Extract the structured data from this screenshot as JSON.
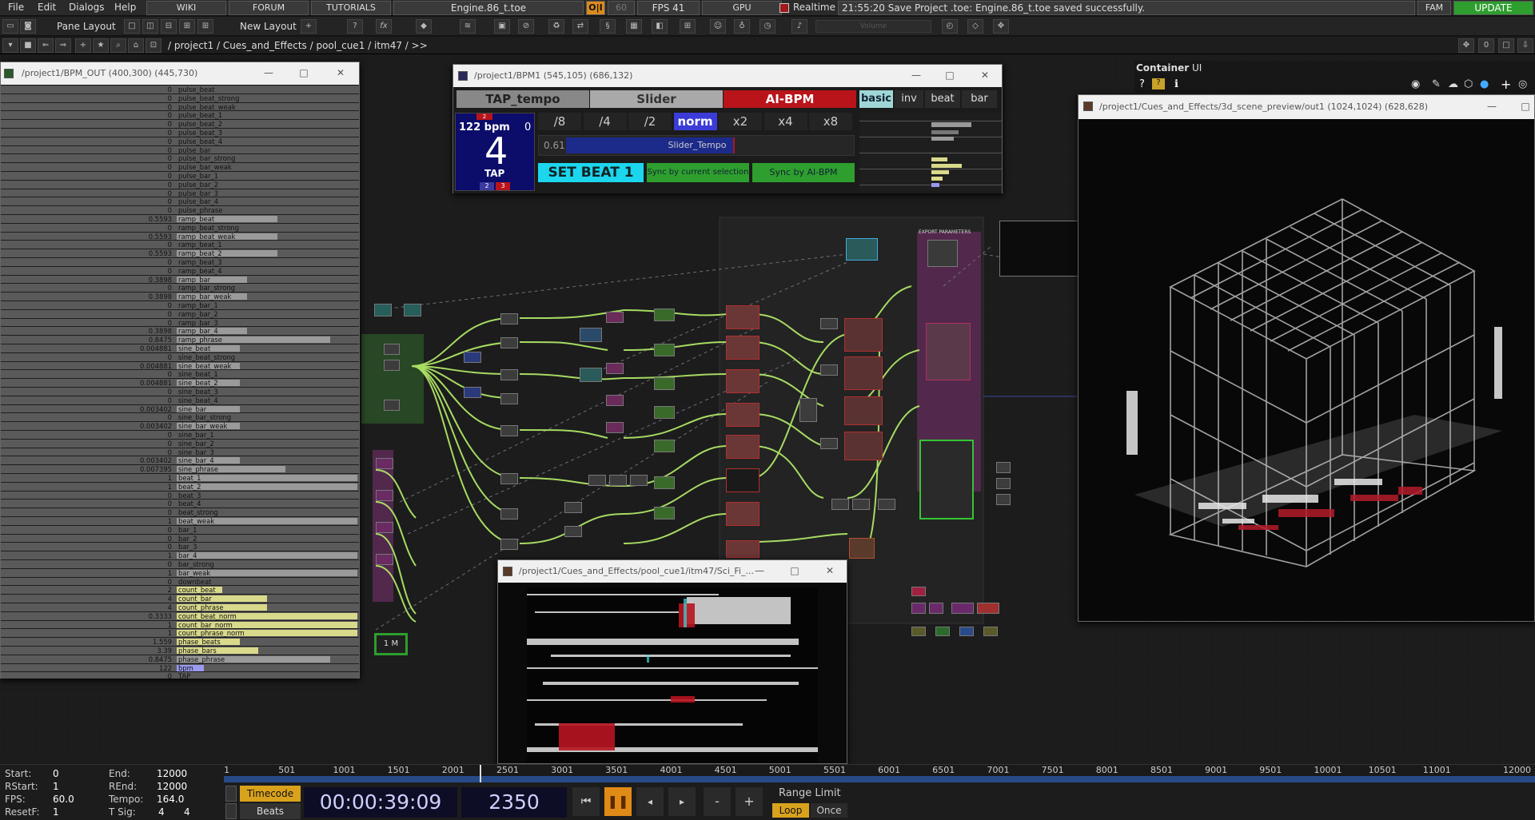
{
  "menu": {
    "items": [
      "File",
      "Edit",
      "Dialogs",
      "Help"
    ],
    "wiki": "WIKI",
    "forum": "FORUM",
    "tutorials": "TUTORIALS",
    "project_file": "Engine.86_t.toe",
    "oi_label": "O|I",
    "fps_target": "60",
    "fps_label": "FPS  41",
    "gpu_label": "GPU",
    "realtime_label": "Realtime",
    "status_message": "21:55:20 Save Project .toe: Engine.86_t.toe saved successfully.",
    "fam_label": "FAM",
    "update_label": "UPDATE"
  },
  "toolbar": {
    "pane_layout": "Pane Layout",
    "new_layout": "New Layout",
    "plus": "+",
    "help": "?",
    "fx": "fx",
    "volume": "Volume"
  },
  "pathbar": {
    "path": "/ project1 / Cues_and_Effects / pool_cue1 / itm47 / >>",
    "counter": "0"
  },
  "container_panel": {
    "title": "Container",
    "ui": "UI"
  },
  "bpm_out_window": {
    "title": "/project1/BPM_OUT (400,300) (445,730)",
    "channels": [
      {
        "value": "0",
        "name": "pulse_beat",
        "bar": 0
      },
      {
        "value": "0",
        "name": "pulse_beat_strong",
        "bar": 0
      },
      {
        "value": "0",
        "name": "pulse_beat_weak",
        "bar": 0
      },
      {
        "value": "0",
        "name": "pulse_beat_1",
        "bar": 0
      },
      {
        "value": "0",
        "name": "pulse_beat_2",
        "bar": 0
      },
      {
        "value": "0",
        "name": "pulse_beat_3",
        "bar": 0
      },
      {
        "value": "0",
        "name": "pulse_beat_4",
        "bar": 0
      },
      {
        "value": "0",
        "name": "pulse_bar",
        "bar": 0
      },
      {
        "value": "0",
        "name": "pulse_bar_strong",
        "bar": 0
      },
      {
        "value": "0",
        "name": "pulse_bar_weak",
        "bar": 0
      },
      {
        "value": "0",
        "name": "pulse_bar_1",
        "bar": 0
      },
      {
        "value": "0",
        "name": "pulse_bar_2",
        "bar": 0
      },
      {
        "value": "0",
        "name": "pulse_bar_3",
        "bar": 0
      },
      {
        "value": "0",
        "name": "pulse_bar_4",
        "bar": 0
      },
      {
        "value": "0",
        "name": "pulse_phrase",
        "bar": 0
      },
      {
        "value": "0.5593",
        "name": "ramp_beat",
        "bar": 0.5593
      },
      {
        "value": "0",
        "name": "ramp_beat_strong",
        "bar": 0
      },
      {
        "value": "0.5593",
        "name": "ramp_beat_weak",
        "bar": 0.5593
      },
      {
        "value": "0",
        "name": "ramp_beat_1",
        "bar": 0
      },
      {
        "value": "0.5593",
        "name": "ramp_beat_2",
        "bar": 0.5593
      },
      {
        "value": "0",
        "name": "ramp_beat_3",
        "bar": 0
      },
      {
        "value": "0",
        "name": "ramp_beat_4",
        "bar": 0
      },
      {
        "value": "0.3898",
        "name": "ramp_bar",
        "bar": 0.3898
      },
      {
        "value": "0",
        "name": "ramp_bar_strong",
        "bar": 0
      },
      {
        "value": "0.3898",
        "name": "ramp_bar_weak",
        "bar": 0.3898
      },
      {
        "value": "0",
        "name": "ramp_bar_1",
        "bar": 0
      },
      {
        "value": "0",
        "name": "ramp_bar_2",
        "bar": 0
      },
      {
        "value": "0",
        "name": "ramp_bar_3",
        "bar": 0
      },
      {
        "value": "0.3898",
        "name": "ramp_bar_4",
        "bar": 0.3898
      },
      {
        "value": "0.8475",
        "name": "ramp_phrase",
        "bar": 0.8475
      },
      {
        "value": "0.004881",
        "name": "sine_beat",
        "bar": 0.35
      },
      {
        "value": "0",
        "name": "sine_beat_strong",
        "bar": 0
      },
      {
        "value": "0.004881",
        "name": "sine_beat_weak",
        "bar": 0.35
      },
      {
        "value": "0",
        "name": "sine_beat_1",
        "bar": 0
      },
      {
        "value": "0.004881",
        "name": "sine_beat_2",
        "bar": 0.35
      },
      {
        "value": "0",
        "name": "sine_beat_3",
        "bar": 0
      },
      {
        "value": "0",
        "name": "sine_beat_4",
        "bar": 0
      },
      {
        "value": "0.003402",
        "name": "sine_bar",
        "bar": 0.35
      },
      {
        "value": "0",
        "name": "sine_bar_strong",
        "bar": 0
      },
      {
        "value": "0.003402",
        "name": "sine_bar_weak",
        "bar": 0.35
      },
      {
        "value": "0",
        "name": "sine_bar_1",
        "bar": 0
      },
      {
        "value": "0",
        "name": "sine_bar_2",
        "bar": 0
      },
      {
        "value": "0",
        "name": "sine_bar_3",
        "bar": 0
      },
      {
        "value": "0.003402",
        "name": "sine_bar_4",
        "bar": 0.35
      },
      {
        "value": "0.007395",
        "name": "sine_phrase",
        "bar": 0.6
      },
      {
        "value": "1",
        "name": "beat_1",
        "bar": 1
      },
      {
        "value": "1",
        "name": "beat_2",
        "bar": 1
      },
      {
        "value": "0",
        "name": "beat_3",
        "bar": 0
      },
      {
        "value": "0",
        "name": "beat_4",
        "bar": 0
      },
      {
        "value": "0",
        "name": "beat_strong",
        "bar": 0
      },
      {
        "value": "1",
        "name": "beat_weak",
        "bar": 1
      },
      {
        "value": "0",
        "name": "bar_1",
        "bar": 0
      },
      {
        "value": "0",
        "name": "bar_2",
        "bar": 0
      },
      {
        "value": "0",
        "name": "bar_3",
        "bar": 0
      },
      {
        "value": "1",
        "name": "bar_4",
        "bar": 1
      },
      {
        "value": "0",
        "name": "bar_strong",
        "bar": 0
      },
      {
        "value": "1",
        "name": "bar_weak",
        "bar": 1
      },
      {
        "value": "0",
        "name": "downbeat",
        "bar": 0
      },
      {
        "value": "2",
        "name": "count_beat",
        "bar": 0.25
      },
      {
        "value": "4",
        "name": "count_bar",
        "bar": 0.5
      },
      {
        "value": "4",
        "name": "count_phrase",
        "bar": 0.5
      },
      {
        "value": "0.3333",
        "name": "count_beat_norm",
        "bar": 1
      },
      {
        "value": "1",
        "name": "count_bar_norm",
        "bar": 1
      },
      {
        "value": "1",
        "name": "count_phrase_norm",
        "bar": 1
      },
      {
        "value": "1.559",
        "name": "phase_beats",
        "bar": 0.35
      },
      {
        "value": "3.39",
        "name": "phase_bars",
        "bar": 0.45
      },
      {
        "value": "0.8475",
        "name": "phase_phrase",
        "bar": 0.8475
      },
      {
        "value": "122",
        "name": "bpm",
        "bar": 0.15
      },
      {
        "value": "0",
        "name": "TAP",
        "bar": 0
      }
    ]
  },
  "bpm1_window": {
    "title": "/project1/BPM1 (545,105) (686,132)",
    "tap_tempo": "TAP_tempo",
    "slider": "Slider",
    "ai_bpm": "AI-BPM",
    "mode_tabs": [
      "basic",
      "inv",
      "beat",
      "bar"
    ],
    "rates": [
      "/8",
      "/4",
      "/2",
      "norm",
      "x2",
      "x4",
      "x8"
    ],
    "bpm_display": "122 bpm",
    "bpm_zero": "0",
    "big_beat": "4",
    "tap_label": "TAP",
    "counter_top": "2",
    "counter_a": "2",
    "counter_b": "3",
    "slider_value": "0.61",
    "slider_name": "Slider_Tempo",
    "slider_fill": 0.58,
    "set_beat": "SET BEAT 1",
    "sync_selection": "Sync by current selection",
    "sync_ai": "Sync by AI-BPM"
  },
  "preview_window": {
    "title": "/project1/Cues_and_Effects/3d_scene_preview/out1 (1024,1024) (628,628)"
  },
  "scifi_window": {
    "title": "/project1/Cues_and_Effects/pool_cue1/itm47/Sci_Fi_..."
  },
  "network": {
    "export_label": "EXPORT PARAMETERS",
    "node_box_label": "1 M"
  },
  "timeline": {
    "start_label": "Start:",
    "start_value": "0",
    "end_label": "End:",
    "end_value": "12000",
    "rstart_label": "RStart:",
    "rstart_value": "1",
    "rend_label": "REnd:",
    "rend_value": "12000",
    "fps_label": "FPS:",
    "fps_value": "60.0",
    "tempo_label": "Tempo:",
    "tempo_value": "164.0",
    "resetf_label": "ResetF:",
    "resetf_value": "1",
    "tsig_label": "T Sig:",
    "tsig_a": "4",
    "tsig_b": "4",
    "timecode_btn": "Timecode",
    "beats_btn": "Beats",
    "timecode": "00:00:39:09",
    "frame": "2350",
    "range_limit": "Range Limit",
    "loop": "Loop",
    "once": "Once",
    "minus": "-",
    "plus": "+",
    "ruler": [
      "1",
      "501",
      "1001",
      "1501",
      "2001",
      "2501",
      "3001",
      "3501",
      "4001",
      "4501",
      "5001",
      "5501",
      "6001",
      "6501",
      "7001",
      "7501",
      "8001",
      "8501",
      "9001",
      "9501",
      "10001",
      "10501",
      "11001",
      "12000"
    ],
    "playhead": 2350,
    "max": 12000
  },
  "colors": {
    "accent_green": "#2e9e2e",
    "ai_red": "#b8141a",
    "norm_blue": "#3b3bd8",
    "set_beat_cyan": "#1cd6ee",
    "wire_green": "#b6f06a",
    "pause_orange": "#e08a18"
  }
}
